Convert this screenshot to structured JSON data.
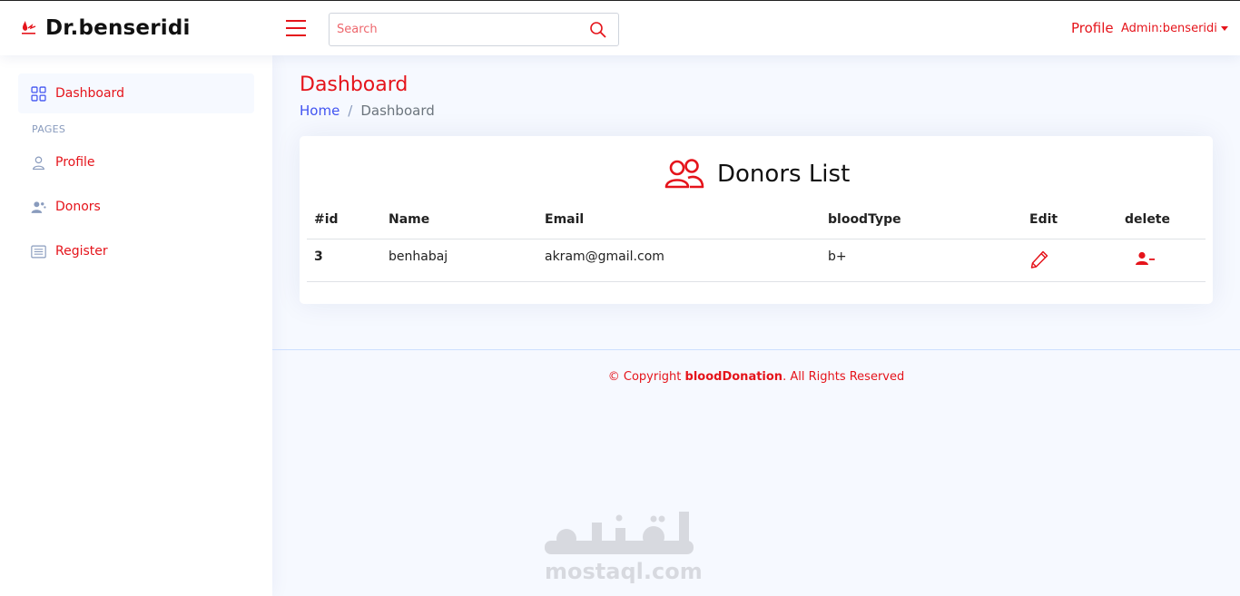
{
  "app": {
    "brand": "Dr.benseridi",
    "accent_color": "#e5141b",
    "link_color": "#4154f1"
  },
  "header": {
    "menu_icon": "hamburger-icon",
    "search_placeholder": "Search",
    "search_icon": "search-icon",
    "profile_label": "Profile",
    "admin_label": "Admin:benseridi"
  },
  "sidebar": {
    "items": [
      {
        "label": "Dashboard",
        "icon": "grid-icon",
        "active": true
      },
      {
        "label": "Profile",
        "icon": "person-icon"
      },
      {
        "label": "Donors",
        "icon": "people-icon"
      },
      {
        "label": "Register",
        "icon": "card-list-icon"
      }
    ],
    "section_heading": "PAGES"
  },
  "main": {
    "page_title": "Dashboard",
    "breadcrumb": {
      "home": "Home",
      "separator": "/",
      "current": "Dashboard"
    },
    "card": {
      "title": "Donors List",
      "title_icon": "people-icon",
      "columns": [
        "#id",
        "Name",
        "Email",
        "bloodType",
        "Edit",
        "delete"
      ],
      "rows": [
        {
          "id": "3",
          "name": "benhabaj",
          "email": "akram@gmail.com",
          "bloodType": "b+",
          "edit_icon": "pencil-icon",
          "delete_icon": "person-dash-icon"
        }
      ]
    }
  },
  "footer": {
    "prefix": "© Copyright ",
    "brand": "bloodDonation",
    "suffix": ". All Rights Reserved"
  },
  "watermark": {
    "arabic": "مستقل",
    "latin": "mostaql.com"
  }
}
